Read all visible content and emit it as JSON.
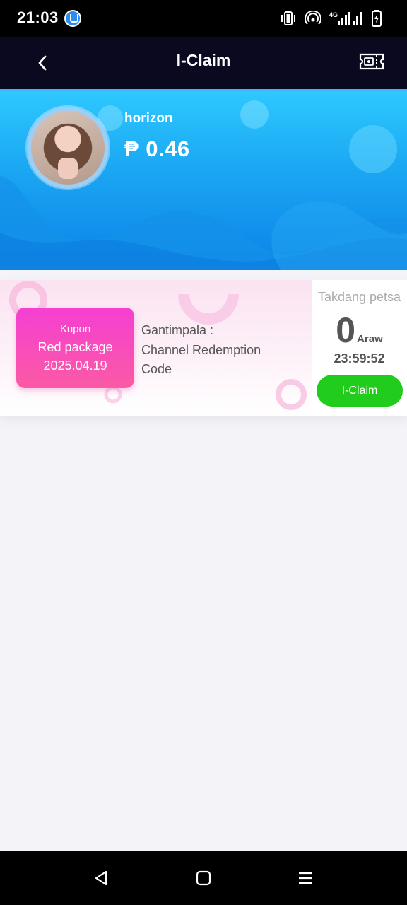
{
  "status_bar": {
    "time": "21:03",
    "app_icon": "security-app-icon",
    "icons": [
      "vibrate-icon",
      "hotspot-icon",
      "signal-4g-icon",
      "signal-bars-icon",
      "battery-charging-icon"
    ]
  },
  "header": {
    "title": "I-Claim",
    "back_icon": "chevron-left-icon",
    "right_icon": "ticket-icon"
  },
  "profile": {
    "username": "horizon",
    "balance": "₱ 0.46"
  },
  "coupon": {
    "type": "Kupon",
    "name": "Red package",
    "date": "2025.04.19",
    "prize_line1": "Gantimpala :",
    "prize_line2": "Channel Redemption",
    "prize_line3": "Code",
    "deadline_label": "Takdang petsa",
    "days": "0",
    "days_unit": "Araw",
    "countdown": "23:59:52",
    "claim_label": "I-Claim"
  },
  "nav_bar": {
    "buttons": [
      "back-triangle-icon",
      "home-square-icon",
      "menu-lines-icon"
    ]
  },
  "colors": {
    "header_bg": "#0b0920",
    "banner_top": "#2ec8ff",
    "banner_bottom": "#0c82ea",
    "coupon_tag": "#f53fd2",
    "claim_button": "#22cc1c",
    "page_bg": "#f3f3f8"
  }
}
